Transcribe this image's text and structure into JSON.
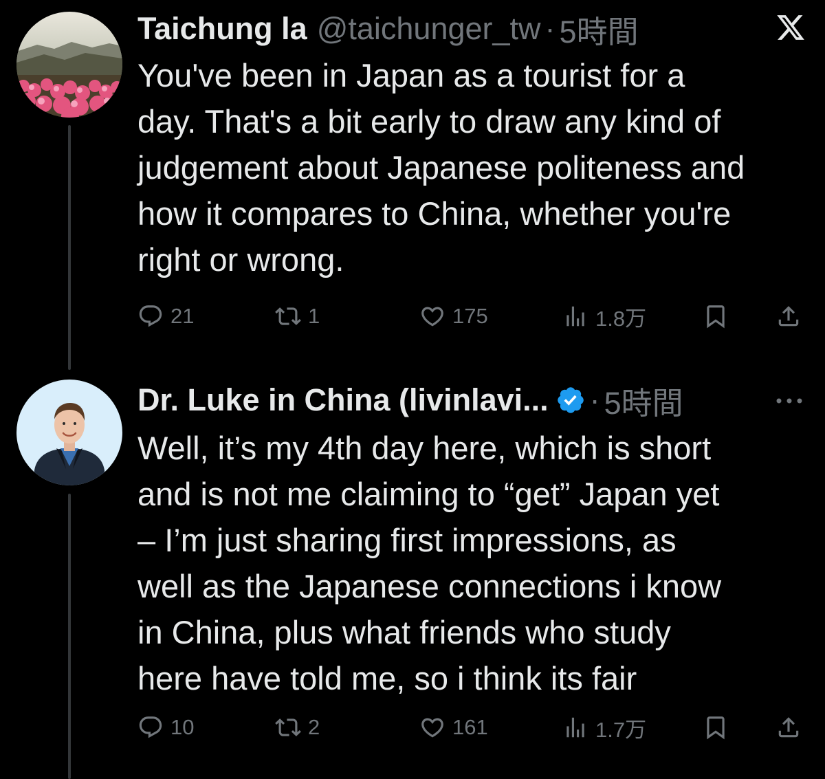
{
  "tweets": [
    {
      "display_name": "Taichung la",
      "handle": "@taichunger_tw",
      "separator": "·",
      "time": "5時間",
      "verified": false,
      "text": "You've been in Japan as a tourist for a\nday. That's a bit early to draw any kind of\njudgement about Japanese politeness and\nhow it compares to China, whether you're\nright or wrong.",
      "stats": {
        "replies": "21",
        "reposts": "1",
        "likes": "175",
        "views": "1.8万"
      },
      "avatar_icon": "landscape-flowers-avatar",
      "corner_icon": "x-logo-icon"
    },
    {
      "display_name": "Dr. Luke in China (livinlavi...",
      "handle": "",
      "separator": "·",
      "time": "5時間",
      "verified": true,
      "text": "Well, it’s my 4th day here, which is short\nand is not me claiming to “get” Japan yet\n– I’m just sharing first impressions, as\nwell as the Japanese connections i know\nin China, plus what friends who study\nhere have told me, so i think its fair",
      "stats": {
        "replies": "10",
        "reposts": "2",
        "likes": "161",
        "views": "1.7万"
      },
      "avatar_icon": "man-portrait-avatar",
      "corner_icon": "more-options-icon"
    }
  ],
  "colors": {
    "background": "#000000",
    "text": "#e7e9ea",
    "muted": "#71767b",
    "verified_badge": "#1d9bf0",
    "thread_line": "#333639"
  }
}
